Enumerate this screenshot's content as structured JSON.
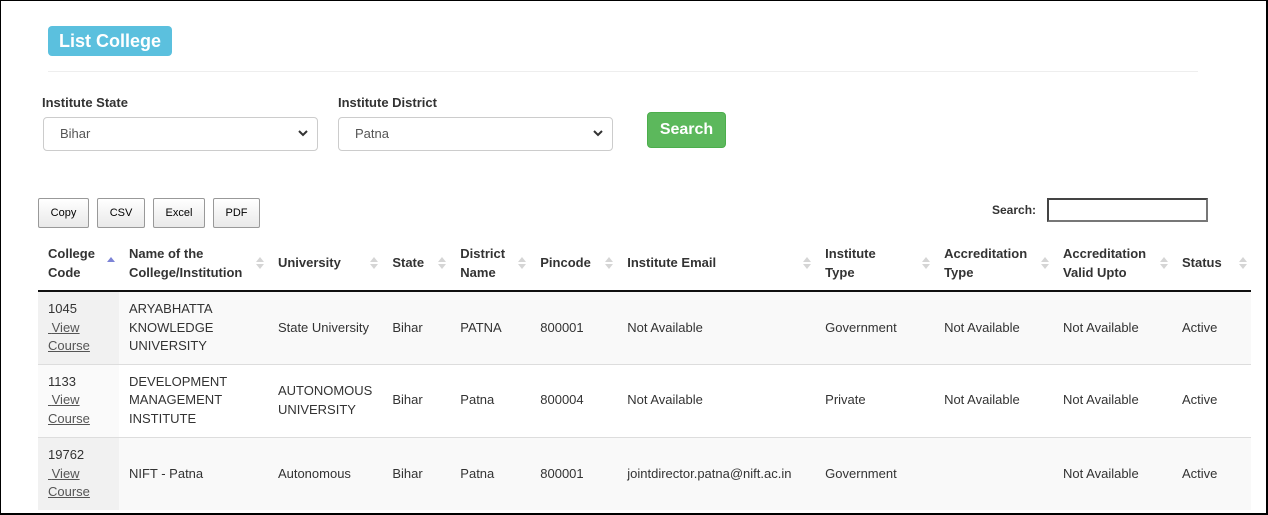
{
  "header": {
    "title": "List College"
  },
  "filters": {
    "state": {
      "label": "Institute State",
      "value": "Bihar"
    },
    "district": {
      "label": "Institute District",
      "value": "Patna"
    },
    "search_button": "Search"
  },
  "export_buttons": [
    "Copy",
    "CSV",
    "Excel",
    "PDF"
  ],
  "table_search": {
    "label": "Search:",
    "value": ""
  },
  "table": {
    "sorted_column": "College Code",
    "sort_direction": "ascending",
    "columns": [
      "College Code",
      "Name of the College/Institution",
      "University",
      "State",
      "District Name",
      "Pincode",
      "Institute Email",
      "Institute Type",
      "Accreditation Type",
      "Accreditation Valid Upto",
      "Status"
    ],
    "column_lines": [
      [
        "College",
        "Code"
      ],
      [
        "Name of the",
        "College/Institution"
      ],
      [
        "University"
      ],
      [
        "State"
      ],
      [
        "District",
        "Name"
      ],
      [
        "Pincode"
      ],
      [
        "Institute Email"
      ],
      [
        "Institute",
        "Type"
      ],
      [
        "Accreditation",
        "Type"
      ],
      [
        "Accreditation",
        "Valid Upto"
      ],
      [
        "Status"
      ]
    ],
    "link_label": "View Course",
    "rows": [
      {
        "code": "1045",
        "name": "ARYABHATTA KNOWLEDGE UNIVERSITY",
        "university": "State University",
        "state": "Bihar",
        "district": "PATNA",
        "pincode": "800001",
        "email": "Not Available",
        "type": "Government",
        "accreditation_type": "Not Available",
        "accreditation_valid_upto": "Not Available",
        "status": "Active"
      },
      {
        "code": "1133",
        "name": "DEVELOPMENT MANAGEMENT INSTITUTE",
        "university": "AUTONOMOUS UNIVERSITY",
        "state": "Bihar",
        "district": "Patna",
        "pincode": "800004",
        "email": "Not Available",
        "type": "Private",
        "accreditation_type": "Not Available",
        "accreditation_valid_upto": "Not Available",
        "status": "Active"
      },
      {
        "code": "19762",
        "name": "NIFT - Patna",
        "university": "Autonomous",
        "state": "Bihar",
        "district": "Patna",
        "pincode": "800001",
        "email": "jointdirector.patna@nift.ac.in",
        "type": "Government",
        "accreditation_type": "",
        "accreditation_valid_upto": "Not Available",
        "status": "Active"
      }
    ]
  },
  "colors": {
    "title_badge": "#5bc0de",
    "search_button": "#5cb85c",
    "sort_active": "#7c83d6",
    "sort_inactive": "#d5d5d5"
  }
}
